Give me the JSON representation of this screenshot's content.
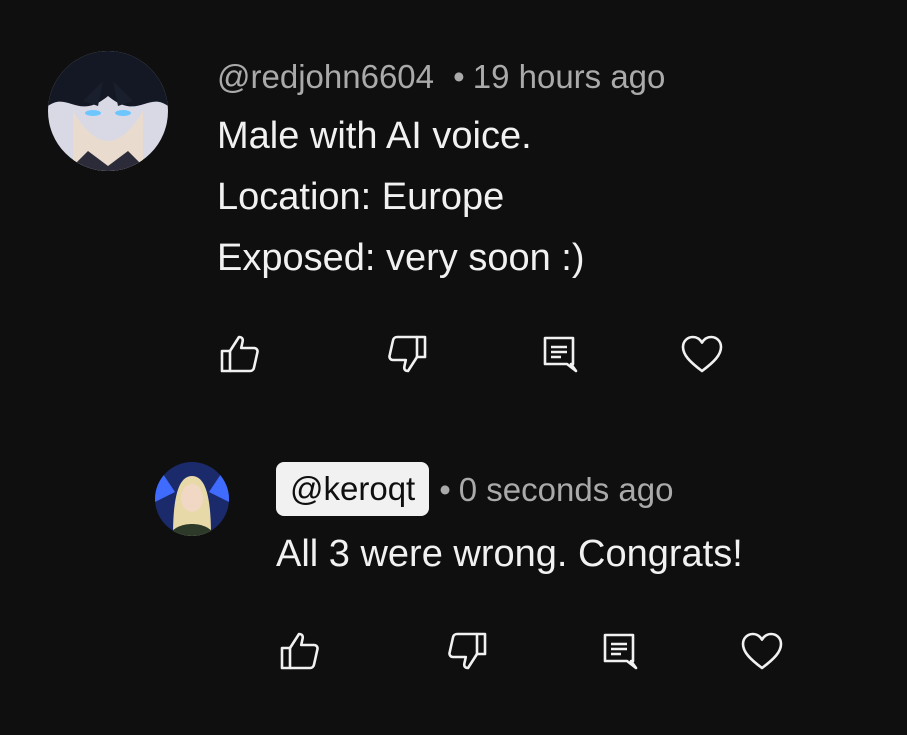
{
  "comment": {
    "handle": "@redjohn6604",
    "separator": "•",
    "time": "19 hours ago",
    "lines": [
      "Male with AI voice.",
      "Location: Europe",
      "Exposed: very soon :)"
    ],
    "actions": {
      "like_icon": "thumbs-up-icon",
      "dislike_icon": "thumbs-down-icon",
      "reply_icon": "comment-reply-icon",
      "heart_icon": "heart-icon"
    }
  },
  "reply": {
    "handle": "@keroqt",
    "separator": "•",
    "time": "0 seconds ago",
    "lines": [
      "All 3 were wrong. Congrats!"
    ],
    "actions": {
      "like_icon": "thumbs-up-icon",
      "dislike_icon": "thumbs-down-icon",
      "reply_icon": "comment-reply-icon",
      "heart_icon": "heart-icon"
    }
  },
  "colors": {
    "background": "#0f0f0f",
    "primary_text": "#f1f1f1",
    "secondary_text": "#aaaaaa",
    "handle_chip_bg": "#f1f1f1"
  }
}
